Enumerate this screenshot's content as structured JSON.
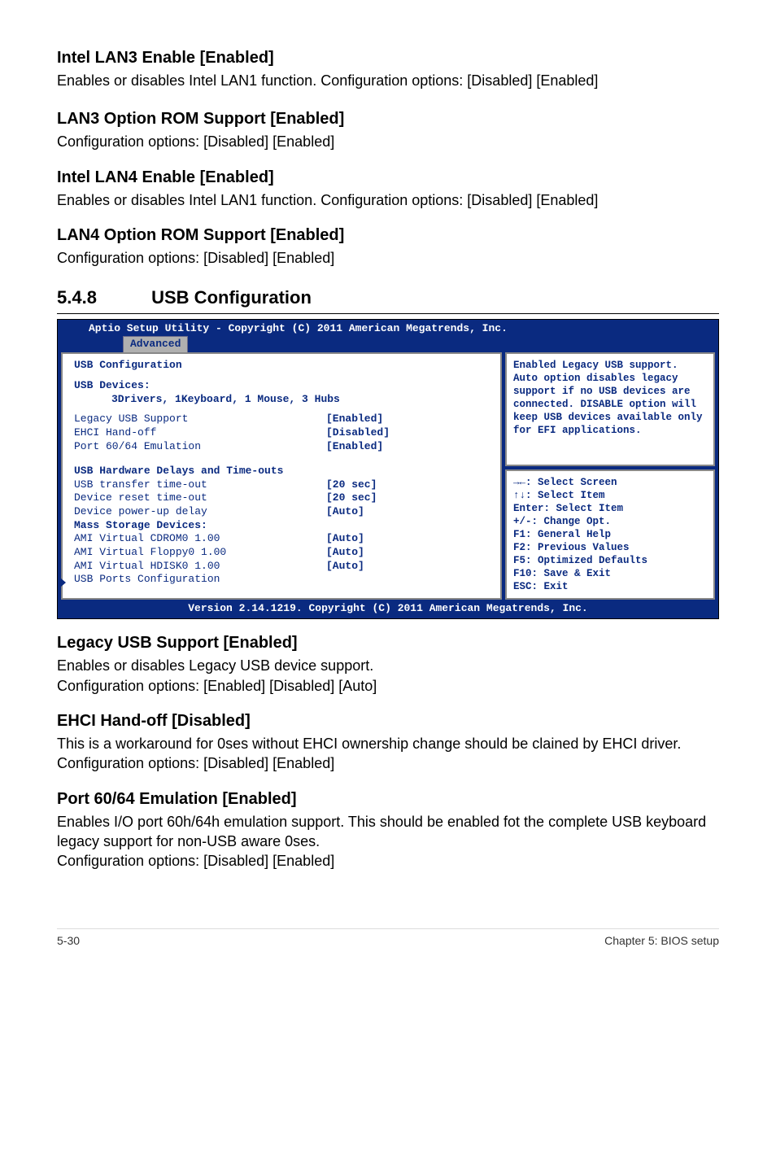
{
  "s1": {
    "title": "Intel LAN3 Enable [Enabled]",
    "text": "Enables or disables Intel LAN1 function. Configuration options: [Disabled] [Enabled]"
  },
  "s2": {
    "title": "LAN3 Option ROM Support [Enabled]",
    "text": "Configuration options: [Disabled] [Enabled]"
  },
  "s3": {
    "title": "Intel LAN4 Enable [Enabled]",
    "text": "Enables or disables Intel LAN1 function. Configuration options: [Disabled] [Enabled]"
  },
  "s4": {
    "title": "LAN4 Option ROM Support [Enabled]",
    "text": "Configuration options: [Disabled] [Enabled]"
  },
  "section": {
    "num": "5.4.8",
    "title": "USB Configuration"
  },
  "bios": {
    "top": "Aptio Setup Utility - Copyright (C) 2011 American Megatrends, Inc.",
    "tab": "Advanced",
    "l1": "USB Configuration",
    "l2": "USB Devices:",
    "l3": "3Drivers, 1Keyboard, 1 Mouse, 3 Hubs",
    "r1l": "Legacy USB Support",
    "r1v": "[Enabled]",
    "r2l": "EHCI Hand-off",
    "r2v": "[Disabled]",
    "r3l": "Port 60/64 Emulation",
    "r3v": "[Enabled]",
    "h2": "USB Hardware Delays and Time-outs",
    "r4l": "USB transfer time-out",
    "r4v": "[20 sec]",
    "r5l": "Device reset time-out",
    "r5v": "[20 sec]",
    "r6l": "Device power-up delay",
    "r6v": "[Auto]",
    "h3": "Mass Storage Devices:",
    "r7l": "AMI Virtual CDROM0 1.00",
    "r7v": "[Auto]",
    "r8l": "AMI Virtual Floppy0 1.00",
    "r8v": "[Auto]",
    "r9l": "AMI Virtual HDISK0 1.00",
    "r9v": "[Auto]",
    "sub": "USB Ports Configuration",
    "help": "Enabled Legacy USB support. Auto  option disables legacy support if no USB devices are connected. DISABLE option will keep USB devices available only for EFI applications.",
    "nav1": "→←: Select Screen",
    "nav2": "↑↓:  Select Item",
    "nav3": "Enter: Select Item",
    "nav4": "+/-: Change Opt.",
    "nav5": "F1: General Help",
    "nav6": "F2: Previous Values",
    "nav7": "F5: Optimized Defaults",
    "nav8": "F10: Save & Exit",
    "nav9": "ESC: Exit",
    "footer": "Version 2.14.1219. Copyright (C) 2011 American Megatrends, Inc."
  },
  "s5": {
    "title": "Legacy USB Support [Enabled]",
    "l1": "Enables or disables Legacy USB device support.",
    "l2": "Configuration options: [Enabled] [Disabled] [Auto]"
  },
  "s6": {
    "title": "EHCI Hand-off [Disabled]",
    "text": "This is a workaround for 0ses without EHCI ownership change should be clained by EHCI driver. Configuration options: [Disabled] [Enabled]"
  },
  "s7": {
    "title": "Port 60/64 Emulation [Enabled]",
    "l1": "Enables I/O port 60h/64h emulation support. This should be enabled fot the complete USB keyboard legacy support for non-USB aware 0ses.",
    "l2": "Configuration options: [Disabled] [Enabled]"
  },
  "footer": {
    "left": "5-30",
    "right": "Chapter 5: BIOS setup"
  }
}
